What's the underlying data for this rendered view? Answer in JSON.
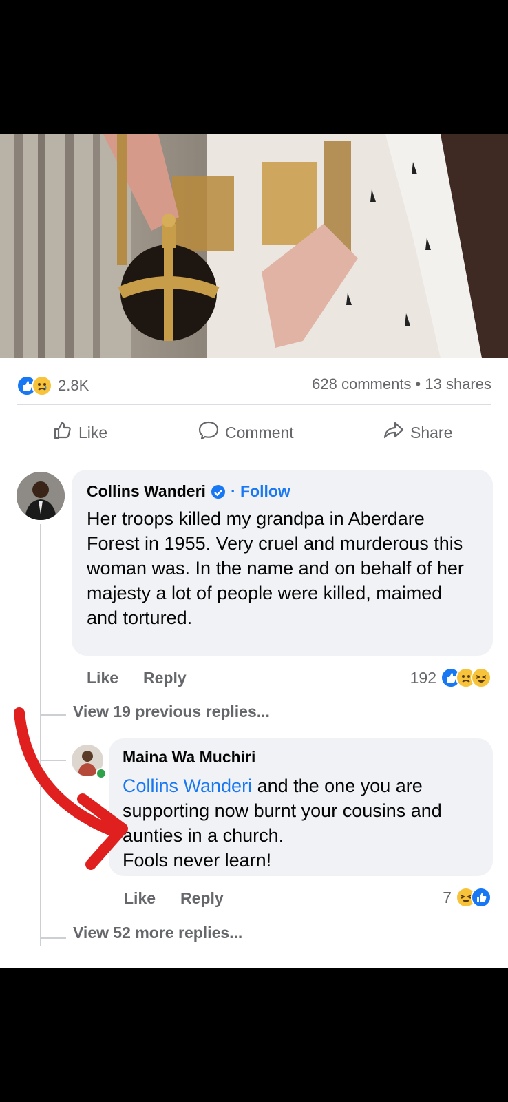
{
  "post": {
    "reactions": {
      "count": "2.8K",
      "icons": [
        "like-icon",
        "sad-icon"
      ]
    },
    "stats": {
      "comments_shares": "628 comments • 13 shares"
    },
    "actions": {
      "like": "Like",
      "comment": "Comment",
      "share": "Share"
    }
  },
  "comment": {
    "author": "Collins Wanderi",
    "follow": "· Follow",
    "text": "Her troops killed my grandpa in Aberdare Forest in 1955. Very cruel and murderous this woman was. In the name and on behalf of her majesty a lot of people were killed, maimed and tortured.",
    "like": "Like",
    "reply": "Reply",
    "reaction_count": "192",
    "view_previous": "View 19 previous replies..."
  },
  "reply": {
    "author": "Maina Wa Muchiri",
    "mention": "Collins Wanderi",
    "text": " and the one you are supporting now burnt your cousins and aunties in a church.",
    "text2": "Fools never learn!",
    "like": "Like",
    "reply": "Reply",
    "reaction_count": "7",
    "view_more": "View 52 more replies..."
  },
  "colors": {
    "accent": "#1877f2",
    "annotation_arrow": "#e0201f"
  }
}
